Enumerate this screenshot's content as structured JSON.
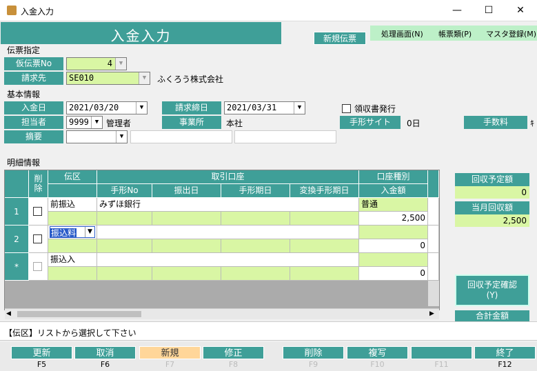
{
  "window": {
    "title": "入金入力",
    "minimize": "—",
    "maximize": "☐",
    "close": "✕"
  },
  "header": {
    "title": "入金入力",
    "mode_badge": "新規伝票"
  },
  "menu": [
    {
      "label": "処理画面(N)"
    },
    {
      "label": "帳票類(P)"
    },
    {
      "label": "マスタ登録(M)"
    }
  ],
  "slip": {
    "section": "伝票指定",
    "temp_no_label": "仮伝票No",
    "temp_no_value": "4",
    "billing_label": "請求先",
    "billing_code": "SE010",
    "billing_name": "ふくろう株式会社"
  },
  "basic": {
    "section": "基本情報",
    "date_label": "入金日",
    "date_value": "2021/03/20",
    "close_label": "請求締日",
    "close_value": "2021/03/31",
    "receipt_label": "領収書発行",
    "staff_label": "担当者",
    "staff_code": "9999",
    "staff_name": "管理者",
    "office_label": "事業所",
    "office_value": "本社",
    "bill_site_label": "手形サイト",
    "bill_site_value": "0日",
    "fee_label": "手数料",
    "fee_trunc": "ｷ",
    "memo_label": "摘要"
  },
  "details": {
    "section": "明細情報",
    "headers": {
      "del": "削\n除",
      "den": "伝区",
      "account": "取引口座",
      "acct_type": "口座種別",
      "bill_no": "手形No",
      "issue_date": "振出日",
      "due_date": "手形期日",
      "exchange": "変換手形期日",
      "amount": "入金額"
    },
    "rows": [
      {
        "num": "1",
        "den": "前振込",
        "account": "みずほ銀行",
        "type": "普通",
        "amount": "2,500"
      },
      {
        "num": "2",
        "den": "振込料",
        "account": "",
        "type": "",
        "amount": "0"
      },
      {
        "num": "*",
        "den": "振込入",
        "account": "",
        "type": "",
        "amount": "0"
      }
    ]
  },
  "side": {
    "planned_label": "回収予定額",
    "planned_value": "0",
    "current_label": "当月回収額",
    "current_value": "2,500",
    "confirm_button": "回収予定確認\n(Y)",
    "total_label": "合計金額"
  },
  "status": "【伝区】リストから選択して下さい",
  "fkeys": [
    {
      "label": "更新",
      "key": "F5"
    },
    {
      "label": "取消",
      "key": "F6"
    },
    {
      "label": "新規",
      "key": "F7"
    },
    {
      "label": "修正",
      "key": "F8"
    },
    {
      "label": "削除",
      "key": "F9"
    },
    {
      "label": "複写",
      "key": "F10"
    },
    {
      "label": "",
      "key": "F11"
    },
    {
      "label": "終了",
      "key": "F12"
    }
  ]
}
